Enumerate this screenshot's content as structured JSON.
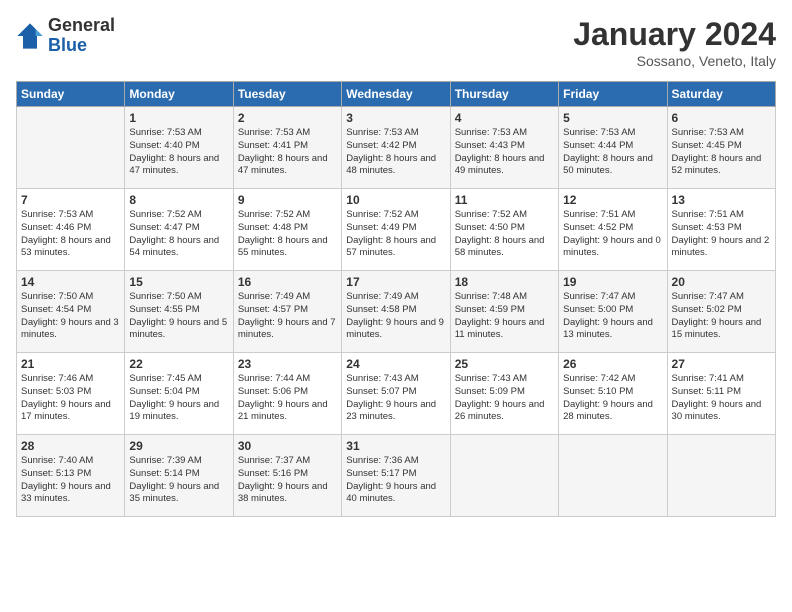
{
  "header": {
    "logo_general": "General",
    "logo_blue": "Blue",
    "month_title": "January 2024",
    "location": "Sossano, Veneto, Italy"
  },
  "days_of_week": [
    "Sunday",
    "Monday",
    "Tuesday",
    "Wednesday",
    "Thursday",
    "Friday",
    "Saturday"
  ],
  "weeks": [
    [
      {
        "day": "",
        "info": ""
      },
      {
        "day": "1",
        "info": "Sunrise: 7:53 AM\nSunset: 4:40 PM\nDaylight: 8 hours\nand 47 minutes."
      },
      {
        "day": "2",
        "info": "Sunrise: 7:53 AM\nSunset: 4:41 PM\nDaylight: 8 hours\nand 47 minutes."
      },
      {
        "day": "3",
        "info": "Sunrise: 7:53 AM\nSunset: 4:42 PM\nDaylight: 8 hours\nand 48 minutes."
      },
      {
        "day": "4",
        "info": "Sunrise: 7:53 AM\nSunset: 4:43 PM\nDaylight: 8 hours\nand 49 minutes."
      },
      {
        "day": "5",
        "info": "Sunrise: 7:53 AM\nSunset: 4:44 PM\nDaylight: 8 hours\nand 50 minutes."
      },
      {
        "day": "6",
        "info": "Sunrise: 7:53 AM\nSunset: 4:45 PM\nDaylight: 8 hours\nand 52 minutes."
      }
    ],
    [
      {
        "day": "7",
        "info": "Sunrise: 7:53 AM\nSunset: 4:46 PM\nDaylight: 8 hours\nand 53 minutes."
      },
      {
        "day": "8",
        "info": "Sunrise: 7:52 AM\nSunset: 4:47 PM\nDaylight: 8 hours\nand 54 minutes."
      },
      {
        "day": "9",
        "info": "Sunrise: 7:52 AM\nSunset: 4:48 PM\nDaylight: 8 hours\nand 55 minutes."
      },
      {
        "day": "10",
        "info": "Sunrise: 7:52 AM\nSunset: 4:49 PM\nDaylight: 8 hours\nand 57 minutes."
      },
      {
        "day": "11",
        "info": "Sunrise: 7:52 AM\nSunset: 4:50 PM\nDaylight: 8 hours\nand 58 minutes."
      },
      {
        "day": "12",
        "info": "Sunrise: 7:51 AM\nSunset: 4:52 PM\nDaylight: 9 hours\nand 0 minutes."
      },
      {
        "day": "13",
        "info": "Sunrise: 7:51 AM\nSunset: 4:53 PM\nDaylight: 9 hours\nand 2 minutes."
      }
    ],
    [
      {
        "day": "14",
        "info": "Sunrise: 7:50 AM\nSunset: 4:54 PM\nDaylight: 9 hours\nand 3 minutes."
      },
      {
        "day": "15",
        "info": "Sunrise: 7:50 AM\nSunset: 4:55 PM\nDaylight: 9 hours\nand 5 minutes."
      },
      {
        "day": "16",
        "info": "Sunrise: 7:49 AM\nSunset: 4:57 PM\nDaylight: 9 hours\nand 7 minutes."
      },
      {
        "day": "17",
        "info": "Sunrise: 7:49 AM\nSunset: 4:58 PM\nDaylight: 9 hours\nand 9 minutes."
      },
      {
        "day": "18",
        "info": "Sunrise: 7:48 AM\nSunset: 4:59 PM\nDaylight: 9 hours\nand 11 minutes."
      },
      {
        "day": "19",
        "info": "Sunrise: 7:47 AM\nSunset: 5:00 PM\nDaylight: 9 hours\nand 13 minutes."
      },
      {
        "day": "20",
        "info": "Sunrise: 7:47 AM\nSunset: 5:02 PM\nDaylight: 9 hours\nand 15 minutes."
      }
    ],
    [
      {
        "day": "21",
        "info": "Sunrise: 7:46 AM\nSunset: 5:03 PM\nDaylight: 9 hours\nand 17 minutes."
      },
      {
        "day": "22",
        "info": "Sunrise: 7:45 AM\nSunset: 5:04 PM\nDaylight: 9 hours\nand 19 minutes."
      },
      {
        "day": "23",
        "info": "Sunrise: 7:44 AM\nSunset: 5:06 PM\nDaylight: 9 hours\nand 21 minutes."
      },
      {
        "day": "24",
        "info": "Sunrise: 7:43 AM\nSunset: 5:07 PM\nDaylight: 9 hours\nand 23 minutes."
      },
      {
        "day": "25",
        "info": "Sunrise: 7:43 AM\nSunset: 5:09 PM\nDaylight: 9 hours\nand 26 minutes."
      },
      {
        "day": "26",
        "info": "Sunrise: 7:42 AM\nSunset: 5:10 PM\nDaylight: 9 hours\nand 28 minutes."
      },
      {
        "day": "27",
        "info": "Sunrise: 7:41 AM\nSunset: 5:11 PM\nDaylight: 9 hours\nand 30 minutes."
      }
    ],
    [
      {
        "day": "28",
        "info": "Sunrise: 7:40 AM\nSunset: 5:13 PM\nDaylight: 9 hours\nand 33 minutes."
      },
      {
        "day": "29",
        "info": "Sunrise: 7:39 AM\nSunset: 5:14 PM\nDaylight: 9 hours\nand 35 minutes."
      },
      {
        "day": "30",
        "info": "Sunrise: 7:37 AM\nSunset: 5:16 PM\nDaylight: 9 hours\nand 38 minutes."
      },
      {
        "day": "31",
        "info": "Sunrise: 7:36 AM\nSunset: 5:17 PM\nDaylight: 9 hours\nand 40 minutes."
      },
      {
        "day": "",
        "info": ""
      },
      {
        "day": "",
        "info": ""
      },
      {
        "day": "",
        "info": ""
      }
    ]
  ]
}
